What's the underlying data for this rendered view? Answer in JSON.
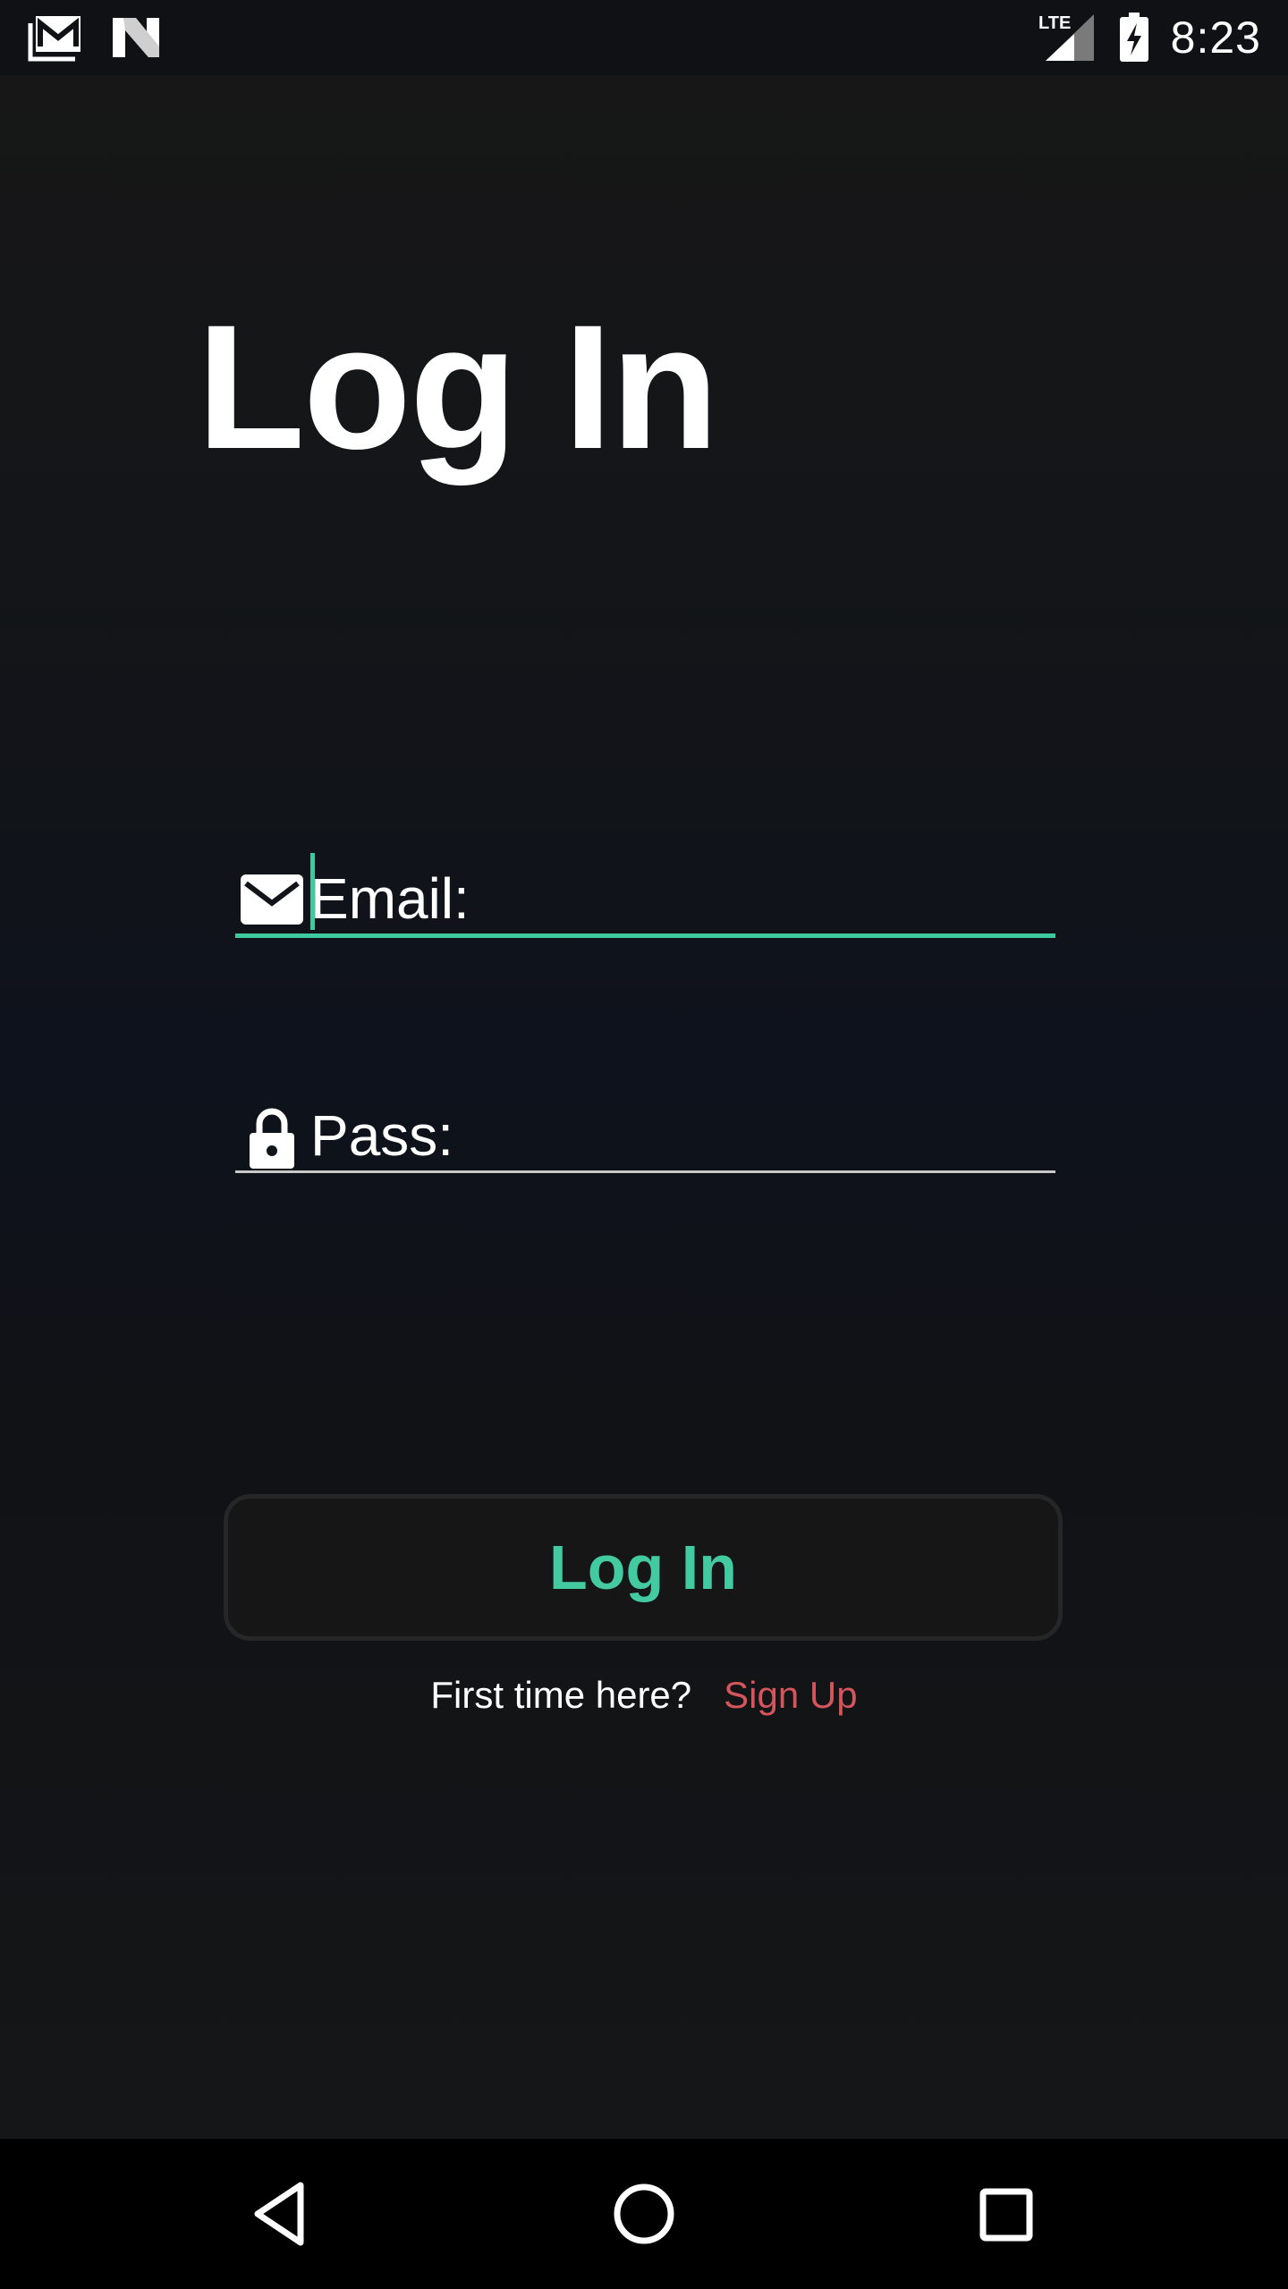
{
  "status_bar": {
    "time": "8:23",
    "network_label": "LTE",
    "left_icons": [
      "gmail-notification-icon",
      "n-notification-icon"
    ],
    "right_icons": [
      "lte-signal-icon",
      "battery-charging-icon"
    ]
  },
  "login": {
    "title": "Log In",
    "email_label": "Email:",
    "password_label": "Pass:",
    "button_label": "Log In",
    "signup_prompt": "First time here?",
    "signup_link": "Sign Up"
  },
  "nav_bar": {
    "icons": [
      "back-icon",
      "home-icon",
      "recents-icon"
    ]
  },
  "colors": {
    "accent": "#3ec99f",
    "link": "#d4565c",
    "background": "#111419",
    "text": "#ffffff"
  }
}
